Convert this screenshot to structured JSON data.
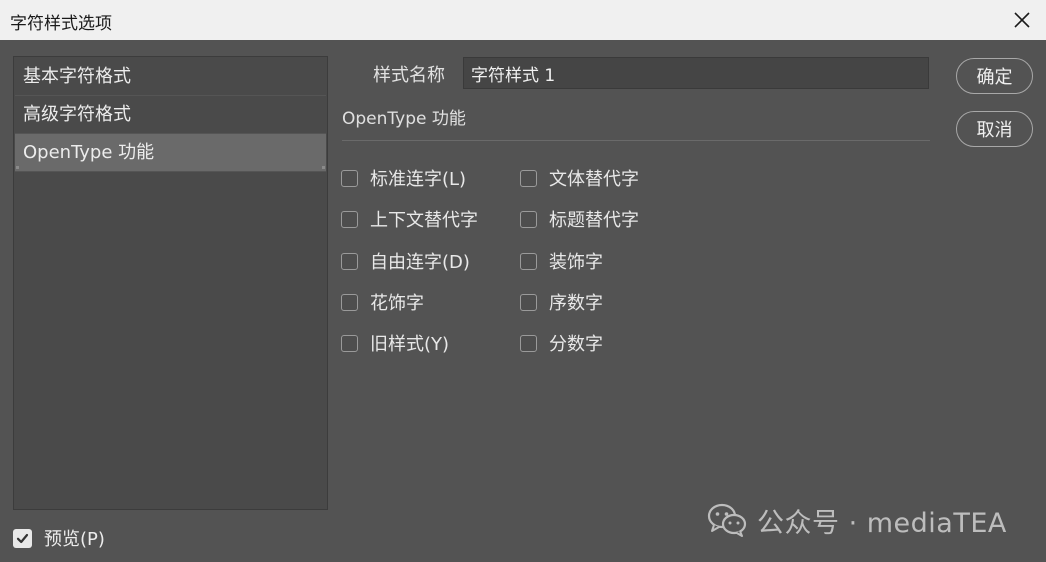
{
  "window": {
    "title": "字符样式选项"
  },
  "sidebar": {
    "items": [
      {
        "label": "基本字符格式",
        "active": false
      },
      {
        "label": "高级字符格式",
        "active": false
      },
      {
        "label": "OpenType 功能",
        "active": true
      }
    ]
  },
  "style_name": {
    "label": "样式名称",
    "value": "字符样式 1"
  },
  "section": {
    "title": "OpenType 功能"
  },
  "options": {
    "left": [
      {
        "label": "标准连字(L)",
        "checked": false
      },
      {
        "label": "上下文替代字",
        "checked": false
      },
      {
        "label": "自由连字(D)",
        "checked": false
      },
      {
        "label": "花饰字",
        "checked": false
      },
      {
        "label": "旧样式(Y)",
        "checked": false
      }
    ],
    "right": [
      {
        "label": "文体替代字",
        "checked": false
      },
      {
        "label": "标题替代字",
        "checked": false
      },
      {
        "label": "装饰字",
        "checked": false
      },
      {
        "label": "序数字",
        "checked": false
      },
      {
        "label": "分数字",
        "checked": false
      }
    ]
  },
  "buttons": {
    "ok": "确定",
    "cancel": "取消"
  },
  "preview": {
    "label": "预览(P)",
    "checked": true
  },
  "watermark": {
    "text": "公众号 · mediaTEA",
    "icon": "wechat-icon"
  },
  "colors": {
    "background": "#535353",
    "titlebar": "#f0f0f0",
    "selected": "#6a6a6a"
  }
}
